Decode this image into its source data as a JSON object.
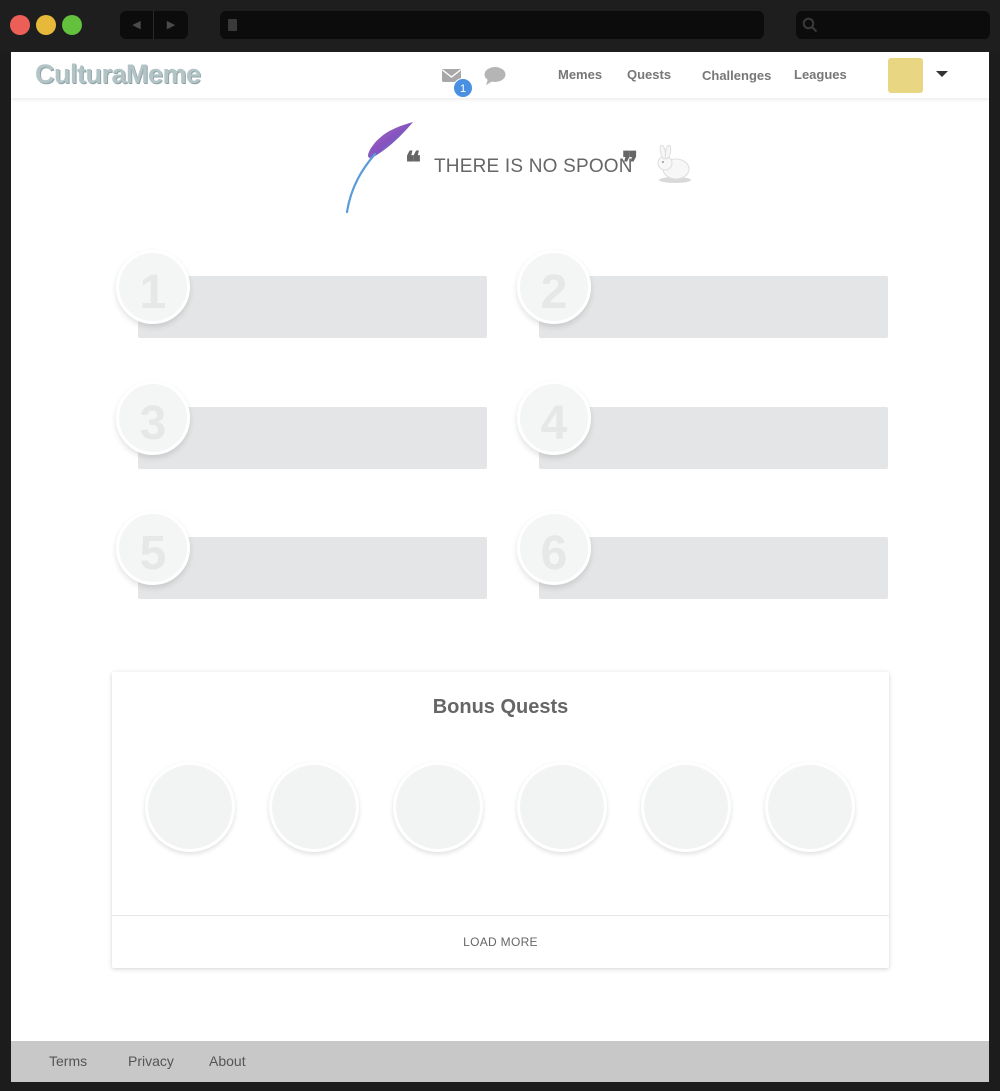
{
  "browser": {
    "back_icon": "back-arrow-icon",
    "forward_icon": "forward-arrow-icon",
    "search_icon": "search-icon"
  },
  "brand": {
    "logo_text": "CulturaMeme"
  },
  "nav": {
    "mail_badge_count": "1",
    "links": [
      {
        "label": "Memes"
      },
      {
        "label": "Quests"
      },
      {
        "label": "Challenges"
      },
      {
        "label": "Leagues"
      }
    ],
    "avatar_color": "#e8d682"
  },
  "quote": {
    "open_mark": "❝",
    "text": "THERE IS NO SPOON",
    "close_mark": "❞"
  },
  "quests": [
    {
      "number": "1"
    },
    {
      "number": "2"
    },
    {
      "number": "3"
    },
    {
      "number": "4"
    },
    {
      "number": "5"
    },
    {
      "number": "6"
    }
  ],
  "bonus": {
    "title": "Bonus Quests",
    "load_more": "LOAD MORE"
  },
  "footer": {
    "links": [
      {
        "label": "Terms"
      },
      {
        "label": "Privacy"
      },
      {
        "label": "About"
      }
    ]
  },
  "colors": {
    "accent_badge": "#4a90e2",
    "slot_bg": "#e3e5e6",
    "footer_bg": "#c8c8c8"
  }
}
